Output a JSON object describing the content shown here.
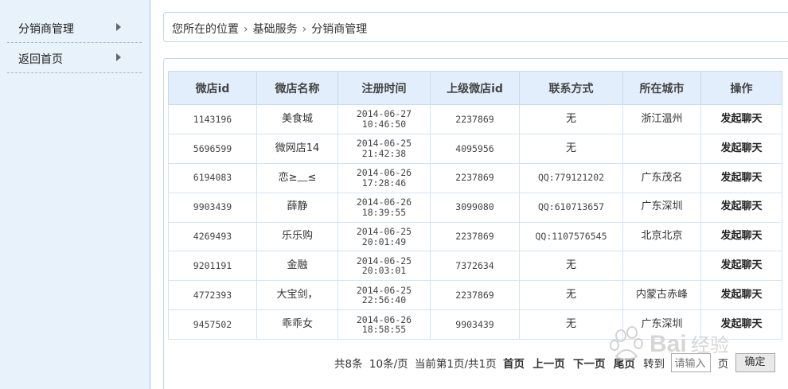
{
  "sidebar": {
    "items": [
      {
        "label": "分销商管理"
      },
      {
        "label": "返回首页"
      }
    ]
  },
  "breadcrumb": {
    "prefix": "您所在的位置",
    "items": [
      "基础服务",
      "分销商管理"
    ]
  },
  "table": {
    "headers": [
      "微店id",
      "微店名称",
      "注册时间",
      "上级微店id",
      "联系方式",
      "所在城市",
      "操作"
    ],
    "rows": [
      {
        "id": "1143196",
        "name": "美食城",
        "date": "2014-06-27",
        "time": "10:46:50",
        "parent": "2237869",
        "contact": "无",
        "city": "浙江温州",
        "action": "发起聊天"
      },
      {
        "id": "5696599",
        "name": "微网店14",
        "date": "2014-06-25",
        "time": "21:42:38",
        "parent": "4095956",
        "contact": "无",
        "city": "",
        "action": "发起聊天"
      },
      {
        "id": "6194083",
        "name": "恋≥﹏≤",
        "date": "2014-06-26",
        "time": "17:28:46",
        "parent": "2237869",
        "contact": "QQ:779121202",
        "city": "广东茂名",
        "action": "发起聊天"
      },
      {
        "id": "9903439",
        "name": "薛静",
        "date": "2014-06-26",
        "time": "18:39:55",
        "parent": "3099080",
        "contact": "QQ:610713657",
        "city": "广东深圳",
        "action": "发起聊天"
      },
      {
        "id": "4269493",
        "name": "乐乐购",
        "date": "2014-06-25",
        "time": "20:01:49",
        "parent": "2237869",
        "contact": "QQ:1107576545",
        "city": "北京北京",
        "action": "发起聊天"
      },
      {
        "id": "9201191",
        "name": "金融",
        "date": "2014-06-25",
        "time": "20:03:01",
        "parent": "7372634",
        "contact": "无",
        "city": "",
        "action": "发起聊天"
      },
      {
        "id": "4772393",
        "name": "大宝剑，",
        "date": "2014-06-25",
        "time": "22:56:40",
        "parent": "2237869",
        "contact": "无",
        "city": "内蒙古赤峰",
        "action": "发起聊天"
      },
      {
        "id": "9457502",
        "name": "乖乖女",
        "date": "2014-06-26",
        "time": "18:58:55",
        "parent": "9903439",
        "contact": "无",
        "city": "广东深圳",
        "action": "发起聊天"
      }
    ]
  },
  "pager": {
    "total": "共8条",
    "per_page": "10条/页",
    "current": "当前第1页/共1页",
    "first": "首页",
    "prev": "上一页",
    "next": "下一页",
    "last": "尾页",
    "goto": "转到",
    "input_placeholder": "请输入",
    "page_unit": "页",
    "confirm": "确定"
  },
  "watermark": {
    "text": "Baidu经验"
  }
}
